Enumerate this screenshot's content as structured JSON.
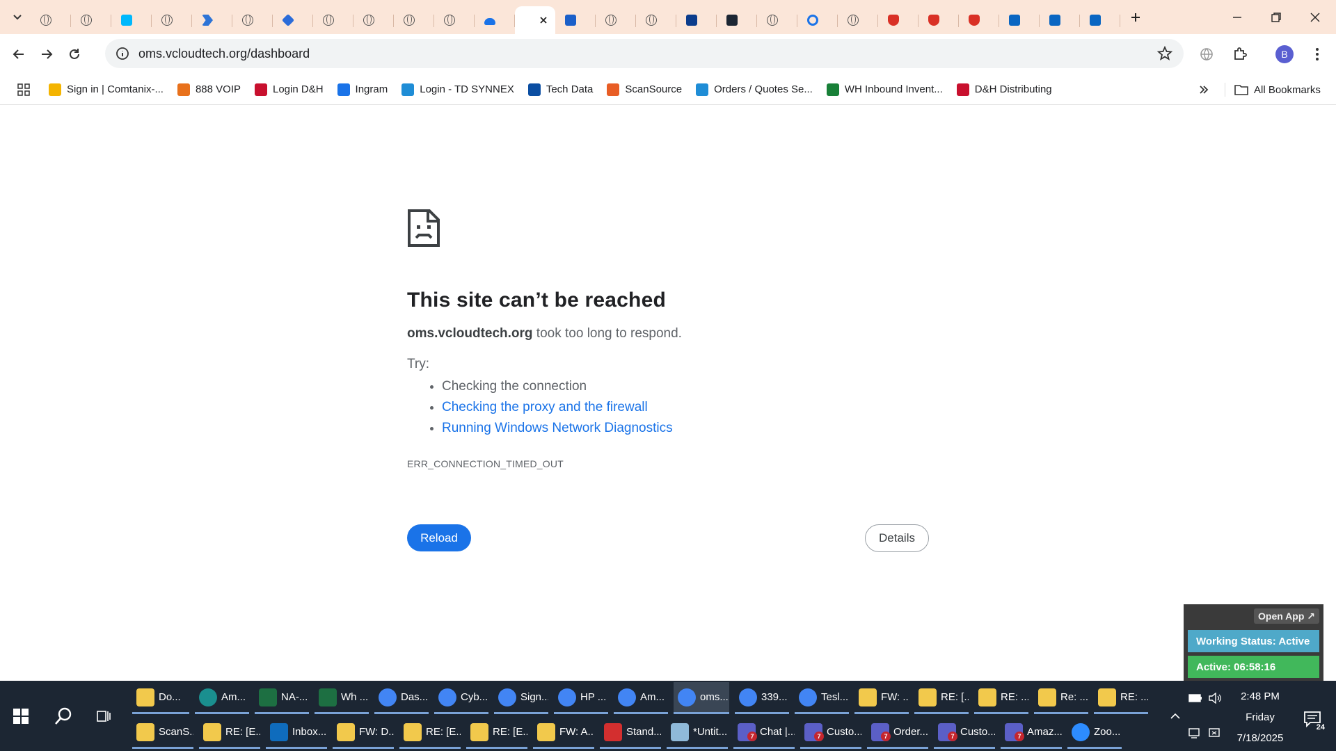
{
  "browser": {
    "active_tab_close": "×",
    "url": "oms.vcloudtech.org/dashboard",
    "avatar_letter": "B"
  },
  "bookmarks": [
    {
      "label": "Sign in | Comtanix-...",
      "icon": "comtanix-icon",
      "color": "#f4b400"
    },
    {
      "label": "888 VOIP",
      "icon": "voip-icon",
      "color": "#e8711c"
    },
    {
      "label": "Login D&H",
      "icon": "dh-icon",
      "color": "#c8102e"
    },
    {
      "label": "Ingram",
      "icon": "ingram-icon",
      "color": "#1a73e8"
    },
    {
      "label": "Login - TD SYNNEX",
      "icon": "tdsynnex-icon",
      "color": "#1f8dd6"
    },
    {
      "label": "Tech Data",
      "icon": "techdata-icon",
      "color": "#0b4ea2"
    },
    {
      "label": "ScanSource",
      "icon": "scansource-icon",
      "color": "#e85d25"
    },
    {
      "label": "Orders / Quotes Se...",
      "icon": "orders-icon",
      "color": "#1f8dd6"
    },
    {
      "label": "WH Inbound Invent...",
      "icon": "sheets-icon",
      "color": "#188038"
    },
    {
      "label": "D&H Distributing",
      "icon": "dh-icon",
      "color": "#c8102e"
    }
  ],
  "all_bookmarks": "All Bookmarks",
  "error": {
    "title": "This site can’t be reached",
    "host": "oms.vcloudtech.org",
    "desc_rest": " took too long to respond.",
    "try": "Try:",
    "suggestions": [
      "Checking the connection",
      "Checking the proxy and the firewall",
      "Running Windows Network Diagnostics"
    ],
    "code": "ERR_CONNECTION_TIMED_OUT",
    "reload": "Reload",
    "details": "Details"
  },
  "widget": {
    "open_app": "Open App ↗",
    "working_status": "Working Status: Active",
    "active_timer": "Active: 06:58:16"
  },
  "taskbar": {
    "row1": [
      {
        "label": "Do...",
        "icon": "files-icon",
        "color": "#f2c94c",
        "width": 82
      },
      {
        "label": "Am...",
        "icon": "edge-icon",
        "color": "#1a8f8f",
        "width": 78
      },
      {
        "label": "NA-...",
        "icon": "excel-icon",
        "color": "#1d6f42",
        "width": 78
      },
      {
        "label": "Wh ...",
        "icon": "excel-icon",
        "color": "#1d6f42",
        "width": 78
      },
      {
        "label": "Das...",
        "icon": "chrome-icon",
        "color": "#4285f4",
        "width": 78
      },
      {
        "label": "Cyb...",
        "icon": "chrome-icon",
        "color": "#4285f4",
        "width": 78
      },
      {
        "label": "Sign...",
        "icon": "chrome-icon",
        "color": "#4285f4",
        "width": 78
      },
      {
        "label": "HP ...",
        "icon": "chrome-icon",
        "color": "#4285f4",
        "width": 78
      },
      {
        "label": "Am...",
        "icon": "chrome-icon",
        "color": "#4285f4",
        "width": 78
      },
      {
        "label": "oms...",
        "icon": "chrome-icon",
        "color": "#4285f4",
        "width": 80,
        "highlight": true
      },
      {
        "label": "339...",
        "icon": "chrome-icon",
        "color": "#4285f4",
        "width": 78
      },
      {
        "label": "Tesl...",
        "icon": "chrome-icon",
        "color": "#4285f4",
        "width": 78
      },
      {
        "label": "FW: ...",
        "icon": "mail-icon",
        "color": "#f2c94c",
        "width": 78
      },
      {
        "label": "RE: [...",
        "icon": "mail-icon",
        "color": "#f2c94c",
        "width": 78
      },
      {
        "label": "RE: ...",
        "icon": "mail-icon",
        "color": "#f2c94c",
        "width": 78
      },
      {
        "label": "Re: ...",
        "icon": "mail-icon",
        "color": "#f2c94c",
        "width": 78
      },
      {
        "label": "RE: ...",
        "icon": "mail-icon",
        "color": "#f2c94c",
        "width": 78
      }
    ],
    "row2": [
      {
        "label": "ScanS...",
        "icon": "mail-icon",
        "color": "#f2c94c",
        "width": 88
      },
      {
        "label": "RE: [E...",
        "icon": "mail-icon",
        "color": "#f2c94c",
        "width": 88
      },
      {
        "label": "Inbox...",
        "icon": "outlook-icon",
        "color": "#0f6cbd",
        "width": 88
      },
      {
        "label": "FW: D...",
        "icon": "mail-icon",
        "color": "#f2c94c",
        "width": 88
      },
      {
        "label": "RE: [E...",
        "icon": "mail-icon",
        "color": "#f2c94c",
        "width": 88
      },
      {
        "label": "RE: [E...",
        "icon": "mail-icon",
        "color": "#f2c94c",
        "width": 88
      },
      {
        "label": "FW: A...",
        "icon": "mail-icon",
        "color": "#f2c94c",
        "width": 88
      },
      {
        "label": "Stand...",
        "icon": "pdf-icon",
        "color": "#d32f2f",
        "width": 88
      },
      {
        "label": "*Untit...",
        "icon": "notepad-icon",
        "color": "#8fb9d9",
        "width": 88
      },
      {
        "label": "Chat |...",
        "icon": "teams-icon",
        "color": "#5b5fc7",
        "width": 88,
        "badge": "7"
      },
      {
        "label": "Custo...",
        "icon": "teams-icon",
        "color": "#5b5fc7",
        "width": 88,
        "badge": "7"
      },
      {
        "label": "Order...",
        "icon": "teams-icon",
        "color": "#5b5fc7",
        "width": 88,
        "badge": "7"
      },
      {
        "label": "Custo...",
        "icon": "teams-icon",
        "color": "#5b5fc7",
        "width": 88,
        "badge": "7"
      },
      {
        "label": "Amaz...",
        "icon": "teams-icon",
        "color": "#5b5fc7",
        "width": 88,
        "badge": "7"
      },
      {
        "label": "Zoo...",
        "icon": "zoom-icon",
        "color": "#2d8cff",
        "width": 78
      }
    ],
    "time": "2:48 PM",
    "day": "Friday",
    "date": "7/18/2025",
    "notifications": "24"
  }
}
